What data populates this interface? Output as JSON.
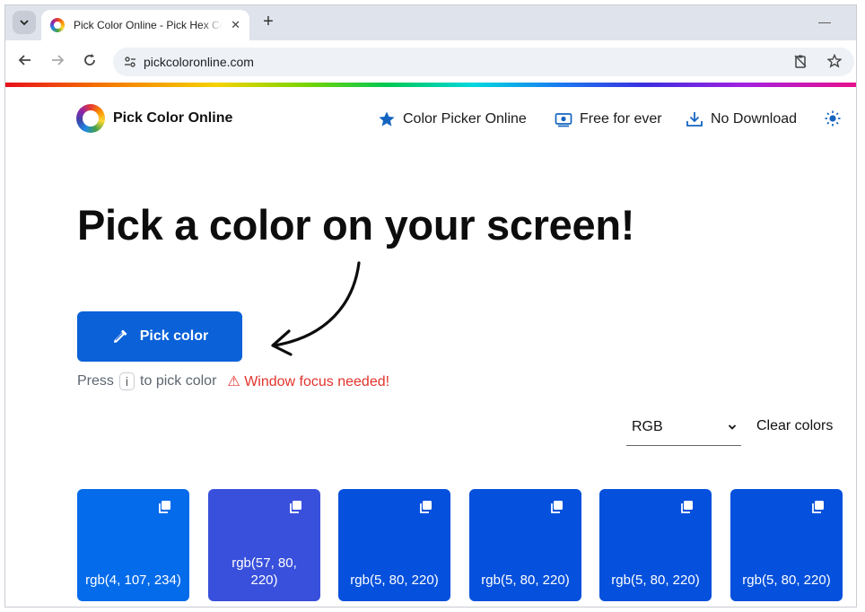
{
  "browser": {
    "tab_title": "Pick Color Online - Pick Hex Color",
    "url": "pickcoloronline.com"
  },
  "site": {
    "logo_text": "Pick Color Online",
    "nav": [
      {
        "label": "Color Picker Online",
        "icon": "star-icon"
      },
      {
        "label": "Free for ever",
        "icon": "money-icon"
      },
      {
        "label": "No Download",
        "icon": "download-icon"
      }
    ],
    "theme_icon": "sun-icon"
  },
  "hero": {
    "title": "Pick a color on your screen!"
  },
  "pick": {
    "button_label": "Pick color",
    "hint_press": "Press",
    "hint_key": "i",
    "hint_rest": "to pick color",
    "warning": "⚠ Window focus needed!"
  },
  "controls": {
    "format_value": "RGB",
    "clear_label": "Clear colors"
  },
  "colors": {
    "swatches": [
      {
        "label": "rgb(4, 107, 234)",
        "hex": "#046bea"
      },
      {
        "label": "rgb(57, 80, 220)",
        "hex": "#3950dc"
      },
      {
        "label": "rgb(5, 80, 220)",
        "hex": "#0550dc"
      },
      {
        "label": "rgb(5, 80, 220)",
        "hex": "#0550dc"
      },
      {
        "label": "rgb(5, 80, 220)",
        "hex": "#0550dc"
      },
      {
        "label": "rgb(5, 80, 220)",
        "hex": "#0550dc"
      }
    ],
    "accent": "#0a61d8",
    "warning": "#e0342c"
  }
}
